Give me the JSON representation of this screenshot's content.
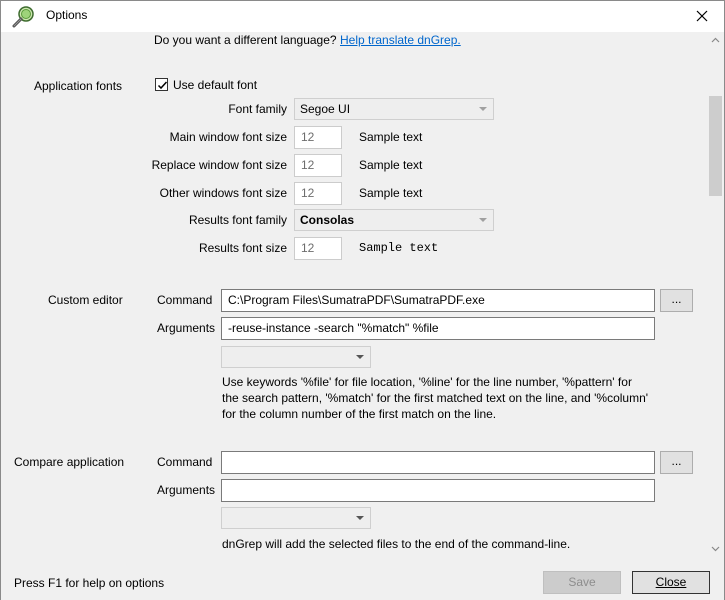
{
  "window": {
    "title": "Options"
  },
  "language": {
    "prompt": "Do you want a different language?",
    "link": "Help translate dnGrep."
  },
  "fonts": {
    "section_label": "Application fonts",
    "use_default_label": "Use default font",
    "use_default_checked": true,
    "font_family_label": "Font family",
    "font_family_value": "Segoe UI",
    "main_size_label": "Main window font size",
    "main_size_value": "12",
    "replace_size_label": "Replace window font size",
    "replace_size_value": "12",
    "other_size_label": "Other windows font size",
    "other_size_value": "12",
    "results_family_label": "Results font family",
    "results_family_value": "Consolas",
    "results_size_label": "Results font size",
    "results_size_value": "12",
    "sample_text": "Sample text"
  },
  "custom_editor": {
    "section_label": "Custom editor",
    "command_label": "Command",
    "command_value": "C:\\Program Files\\SumatraPDF\\SumatraPDF.exe",
    "browse_label": "...",
    "arguments_label": "Arguments",
    "arguments_value": "-reuse-instance -search \"%match\" %file",
    "help_line1": "Use keywords '%file' for file location, '%line' for the line number, '%pattern' for",
    "help_line2": "the search pattern, '%match' for the first matched text on the line, and '%column'",
    "help_line3": "for the column number of the first match on the line."
  },
  "compare": {
    "section_label": "Compare application",
    "command_label": "Command",
    "command_value": "",
    "browse_label": "...",
    "arguments_label": "Arguments",
    "arguments_value": "",
    "help_line": "dnGrep will add the selected files to the end of the command-line."
  },
  "footer": {
    "help_hint": "Press F1 for help on options",
    "save_label": "Save",
    "close_label": "Close"
  },
  "colors": {
    "link": "#0066cc",
    "window_bg": "#f0f0f0"
  }
}
